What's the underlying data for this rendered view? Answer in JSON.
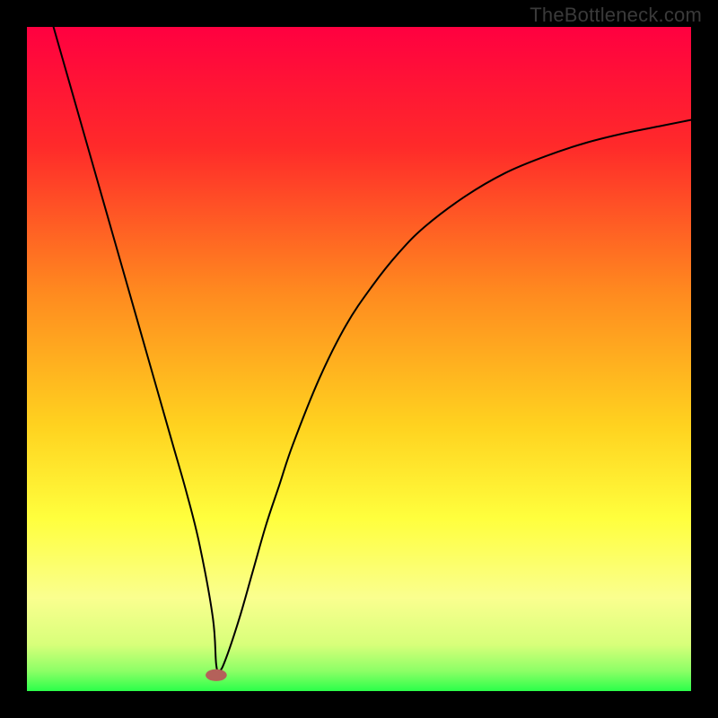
{
  "watermark": "TheBottleneck.com",
  "chart_data": {
    "type": "line",
    "title": "",
    "xlabel": "",
    "ylabel": "",
    "xlim": [
      0,
      100
    ],
    "ylim": [
      0,
      100
    ],
    "gradient_stops": [
      {
        "offset": 0,
        "color": "#ff0040"
      },
      {
        "offset": 18,
        "color": "#ff2a2a"
      },
      {
        "offset": 40,
        "color": "#ff8a1f"
      },
      {
        "offset": 60,
        "color": "#ffd21f"
      },
      {
        "offset": 74,
        "color": "#ffff3d"
      },
      {
        "offset": 86,
        "color": "#faff8f"
      },
      {
        "offset": 93,
        "color": "#d8ff7a"
      },
      {
        "offset": 97,
        "color": "#8cff66"
      },
      {
        "offset": 100,
        "color": "#2bff4a"
      }
    ],
    "series": [
      {
        "name": "bottleneck-curve",
        "x": [
          4,
          6,
          8,
          10,
          12,
          14,
          16,
          18,
          20,
          22,
          24,
          26,
          28,
          28.5,
          29,
          30,
          32,
          34,
          36,
          38,
          40,
          44,
          48,
          52,
          56,
          60,
          66,
          72,
          78,
          84,
          90,
          96,
          100
        ],
        "values": [
          100,
          93,
          86,
          79,
          72,
          65,
          58,
          51,
          44,
          37,
          30,
          22,
          11,
          4,
          3,
          5,
          11,
          18,
          25,
          31,
          37,
          47,
          55,
          61,
          66,
          70,
          74.5,
          78,
          80.5,
          82.5,
          84,
          85.2,
          86
        ]
      }
    ],
    "marker": {
      "x": 28.5,
      "y": 2.4,
      "rx": 1.6,
      "ry": 0.9,
      "color": "#b4615a"
    }
  }
}
